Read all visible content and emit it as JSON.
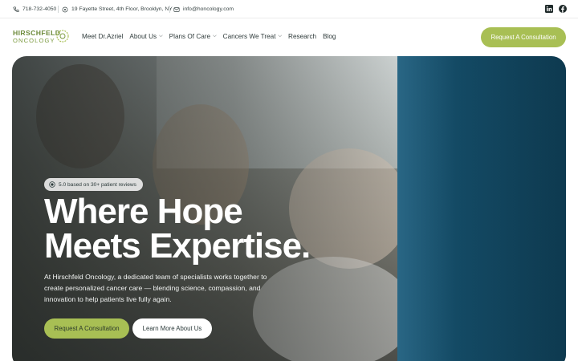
{
  "topbar": {
    "phone": "718-732-4050",
    "address": "19 Fayette Street, 4th Floor, Brooklyn, NY",
    "email": "info@honcology.com",
    "social": [
      {
        "icon": "linkedin-icon"
      },
      {
        "icon": "facebook-icon"
      }
    ]
  },
  "header": {
    "logo": {
      "line1": "HIRSCHFELD",
      "line2": "ONCOLOGY"
    },
    "nav": [
      {
        "label": "Meet Dr.Azriel",
        "has_dropdown": false
      },
      {
        "label": "About Us",
        "has_dropdown": true
      },
      {
        "label": "Plans Of Care",
        "has_dropdown": true
      },
      {
        "label": "Cancers We Treat",
        "has_dropdown": true
      },
      {
        "label": "Research",
        "has_dropdown": false
      },
      {
        "label": "Blog",
        "has_dropdown": false
      }
    ],
    "cta": "Request A Consultation"
  },
  "hero": {
    "rating": "5.0 based on 30+ patient reviews",
    "headline_line1": "Where Hope",
    "headline_line2": "Meets Expertise.",
    "subtext": "At Hirschfeld Oncology, a dedicated team of specialists works together to create personalized cancer care — blending science, compassion, and innovation to help patients live fully again.",
    "primary_button": "Request A Consultation",
    "secondary_button": "Learn More About Us"
  },
  "colors": {
    "accent": "#a8bf54",
    "dark_text": "#2b3a3a",
    "curtain": "#134c68"
  }
}
